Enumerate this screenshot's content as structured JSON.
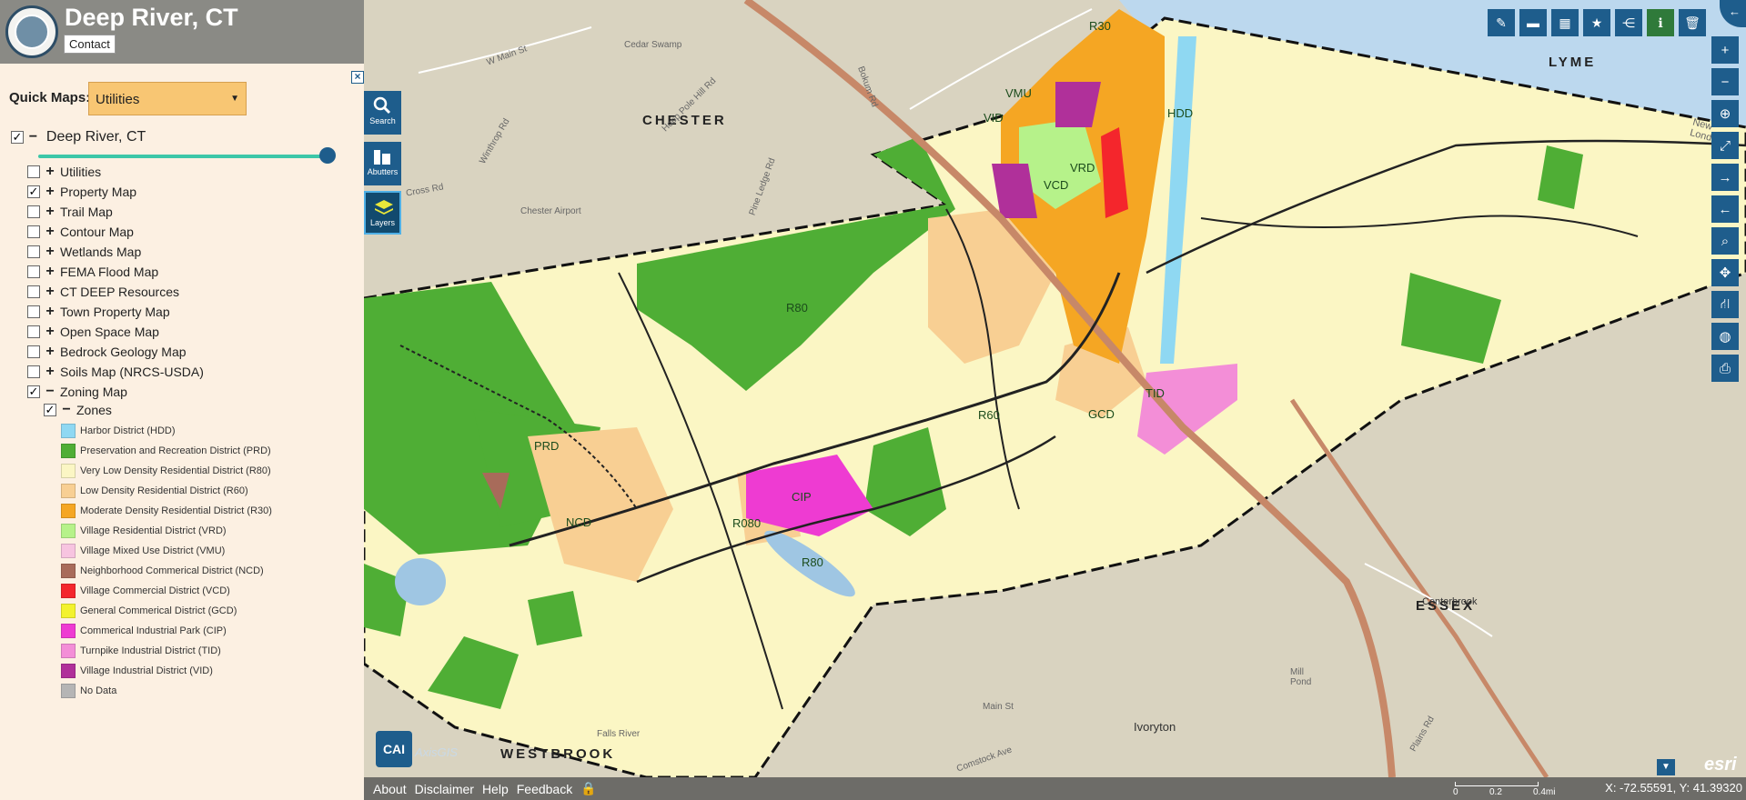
{
  "header": {
    "title": "Deep River, CT",
    "contact_label": "Contact"
  },
  "quick_maps": {
    "label": "Quick Maps:",
    "selected": "Utilities"
  },
  "root_layer": {
    "label": "Deep River, CT",
    "checked": true
  },
  "layers": [
    {
      "label": "Utilities",
      "checked": false,
      "expanded": false
    },
    {
      "label": "Property Map",
      "checked": true,
      "expanded": false
    },
    {
      "label": "Trail Map",
      "checked": false,
      "expanded": false
    },
    {
      "label": "Contour Map",
      "checked": false,
      "expanded": false
    },
    {
      "label": "Wetlands Map",
      "checked": false,
      "expanded": false
    },
    {
      "label": "FEMA Flood Map",
      "checked": false,
      "expanded": false
    },
    {
      "label": "CT DEEP Resources",
      "checked": false,
      "expanded": false
    },
    {
      "label": "Town Property Map",
      "checked": false,
      "expanded": false
    },
    {
      "label": "Open Space Map",
      "checked": false,
      "expanded": false
    },
    {
      "label": "Bedrock Geology Map",
      "checked": false,
      "expanded": false
    },
    {
      "label": "Soils Map (NRCS-USDA)",
      "checked": false,
      "expanded": false
    },
    {
      "label": "Zoning Map",
      "checked": true,
      "expanded": true
    }
  ],
  "zones_group": {
    "label": "Zones",
    "checked": true
  },
  "legend": [
    {
      "label": "Harbor District (HDD)",
      "color": "#8fd8f2"
    },
    {
      "label": "Preservation and Recreation District (PRD)",
      "color": "#4fae35"
    },
    {
      "label": "Very Low Density Residential District (R80)",
      "color": "#fbf6c4"
    },
    {
      "label": "Low Density Residential District (R60)",
      "color": "#f8cf93"
    },
    {
      "label": "Moderate Density Residential District (R30)",
      "color": "#f5a623"
    },
    {
      "label": "Village Residential District (VRD)",
      "color": "#b6f28a"
    },
    {
      "label": "Village Mixed Use District (VMU)",
      "color": "#f7c4e0"
    },
    {
      "label": "Neighborhood Commerical District (NCD)",
      "color": "#a86b5a"
    },
    {
      "label": "Village Commercial District (VCD)",
      "color": "#f4262c"
    },
    {
      "label": "General Commerical District (GCD)",
      "color": "#f3f22d"
    },
    {
      "label": "Commerical Industrial Park (CIP)",
      "color": "#ee3bd2"
    },
    {
      "label": "Turnpike Industrial District (TID)",
      "color": "#f38ed7"
    },
    {
      "label": "Village Industrial District (VID)",
      "color": "#b0309a"
    },
    {
      "label": "No Data",
      "color": "#b5b5b5"
    }
  ],
  "tools": {
    "search": "Search",
    "abutters": "Abutters",
    "layers": "Layers"
  },
  "map_labels": {
    "towns": {
      "chester": "CHESTER",
      "lyme": "LYME",
      "essex": "ESSEX",
      "westbrook": "WESTBROOK"
    },
    "zones": {
      "r30": "R30",
      "vmu": "VMU",
      "vid": "VID",
      "hdd": "HDD",
      "vrd": "VRD",
      "vcd": "VCD",
      "r80_north": "R80",
      "r60": "R60",
      "tid": "TID",
      "gcd": "GCD",
      "prd": "PRD",
      "cip": "CIP",
      "ncd": "NCD",
      "r080": "R080",
      "r80_south": "R80"
    },
    "places": {
      "chester_airport": "Chester Airport",
      "ivoryton": "Ivoryton",
      "centerbrook": "Centerbrook",
      "cedar_swamp": "Cedar Swamp",
      "w_main_st": "W Main St",
      "bokum_rd": "Bokum Rd",
      "pine_ledge_rd": "Pine Ledge Rd",
      "hoop_pole_hill_rd": "Hoop Pole Hill Rd",
      "cross_rd": "Cross Rd",
      "main_st": "Main St",
      "comstock_ave": "Comstock Ave",
      "plains_rd": "Plains Rd",
      "mill_pond": "Mill Pond",
      "new_london": "New London",
      "falls_river": "Falls River",
      "winthrop_rd": "Winthrop Rd"
    }
  },
  "bottom_bar": {
    "about": "About",
    "disclaimer": "Disclaimer",
    "help": "Help",
    "feedback": "Feedback",
    "coords": "X: -72.55591, Y: 41.39320"
  },
  "scale": {
    "t0": "0",
    "t1": "0.2",
    "t2": "0.4mi"
  },
  "attribution": {
    "esri": "esri",
    "cai_logo": "CAI",
    "cai_text": "AxisGIS"
  }
}
